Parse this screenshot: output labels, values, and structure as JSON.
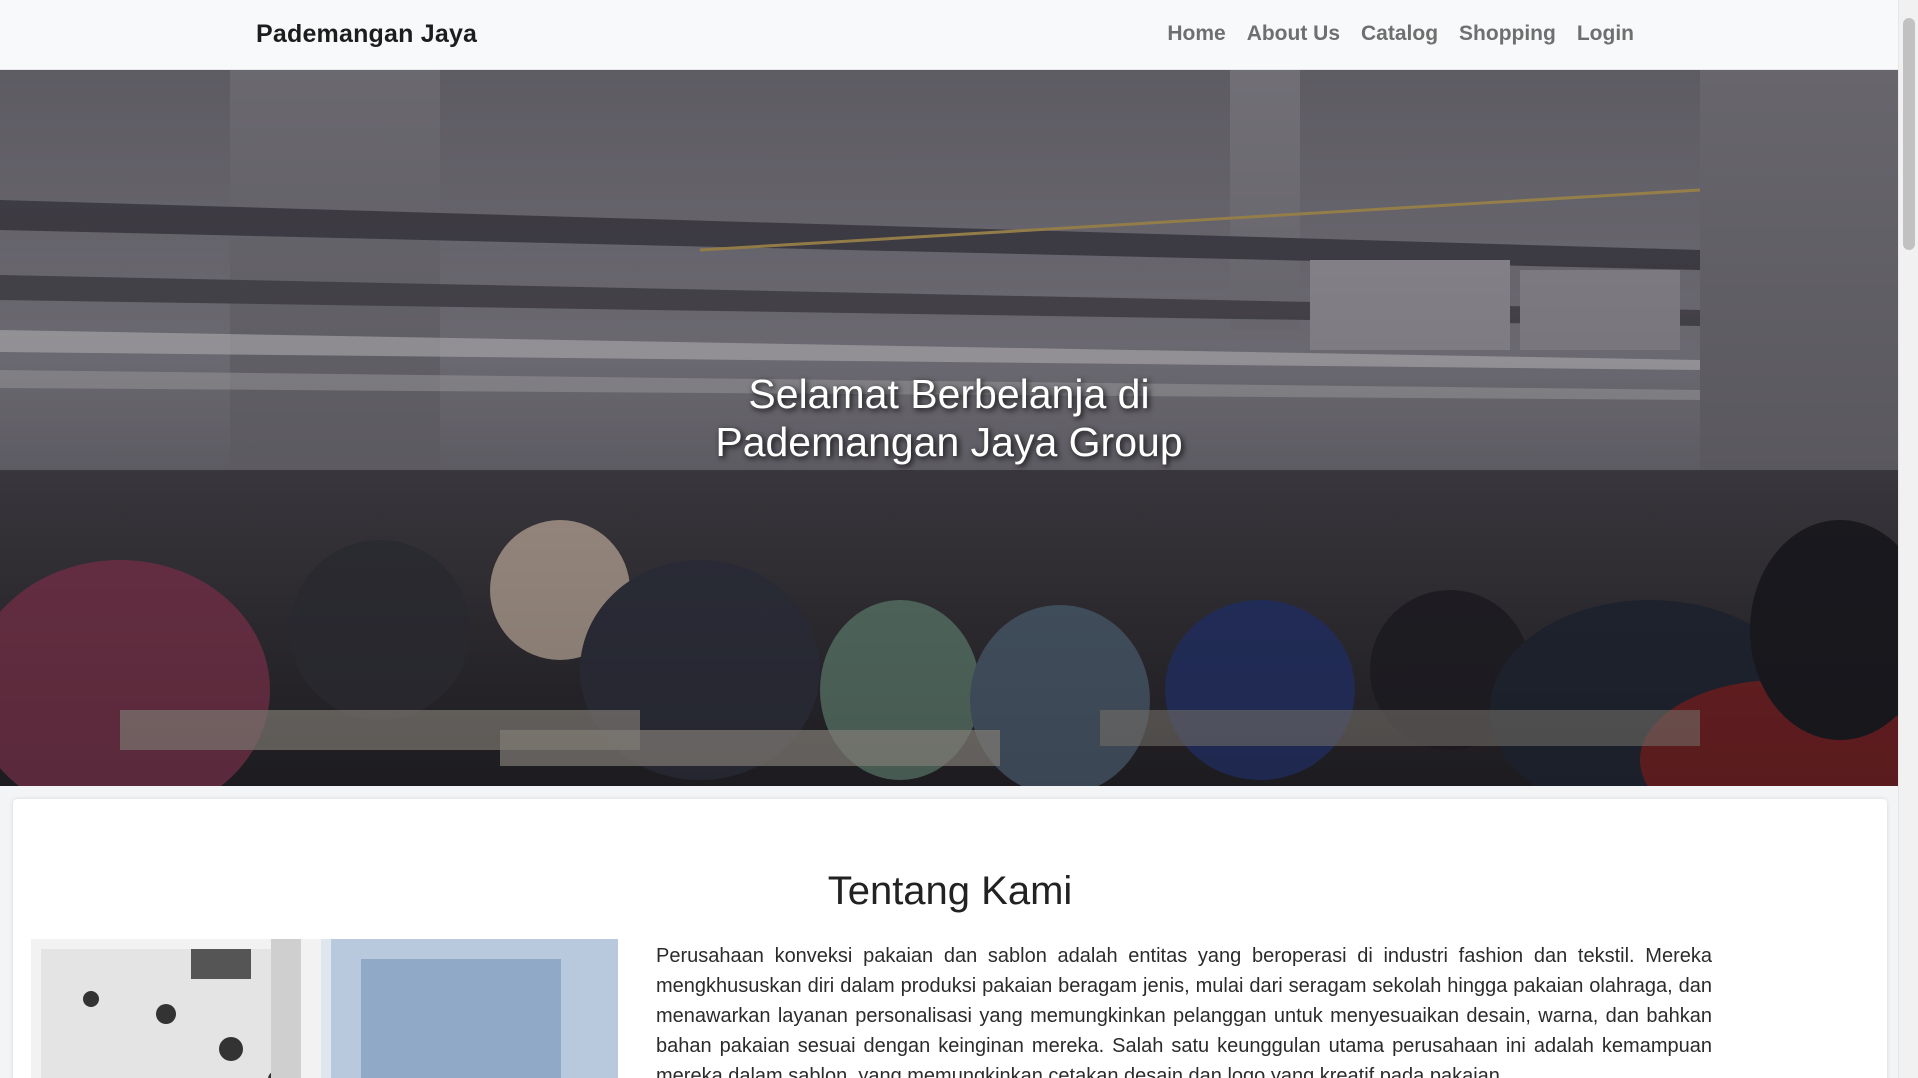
{
  "navbar": {
    "brand": "Pademangan Jaya",
    "links": [
      "Home",
      "About Us",
      "Catalog",
      "Shopping",
      "Login"
    ]
  },
  "hero": {
    "title_line1": "Selamat Berbelanja di",
    "title_line2": "Pademangan Jaya Group"
  },
  "about": {
    "title": "Tentang Kami",
    "paragraph": "Perusahaan konveksi pakaian dan sablon adalah entitas yang beroperasi di industri fashion dan tekstil. Mereka mengkhususkan diri dalam produksi pakaian beragam jenis, mulai dari seragam sekolah hingga pakaian olahraga, dan menawarkan layanan personalisasi yang memungkinkan pelanggan untuk menyesuaikan desain, warna, dan bahkan bahan pakaian sesuai dengan keinginan mereka. Salah satu keunggulan utama perusahaan ini adalah kemampuan mereka dalam sablon, yang memungkinkan cetakan desain dan logo yang kreatif pada pakaian."
  }
}
